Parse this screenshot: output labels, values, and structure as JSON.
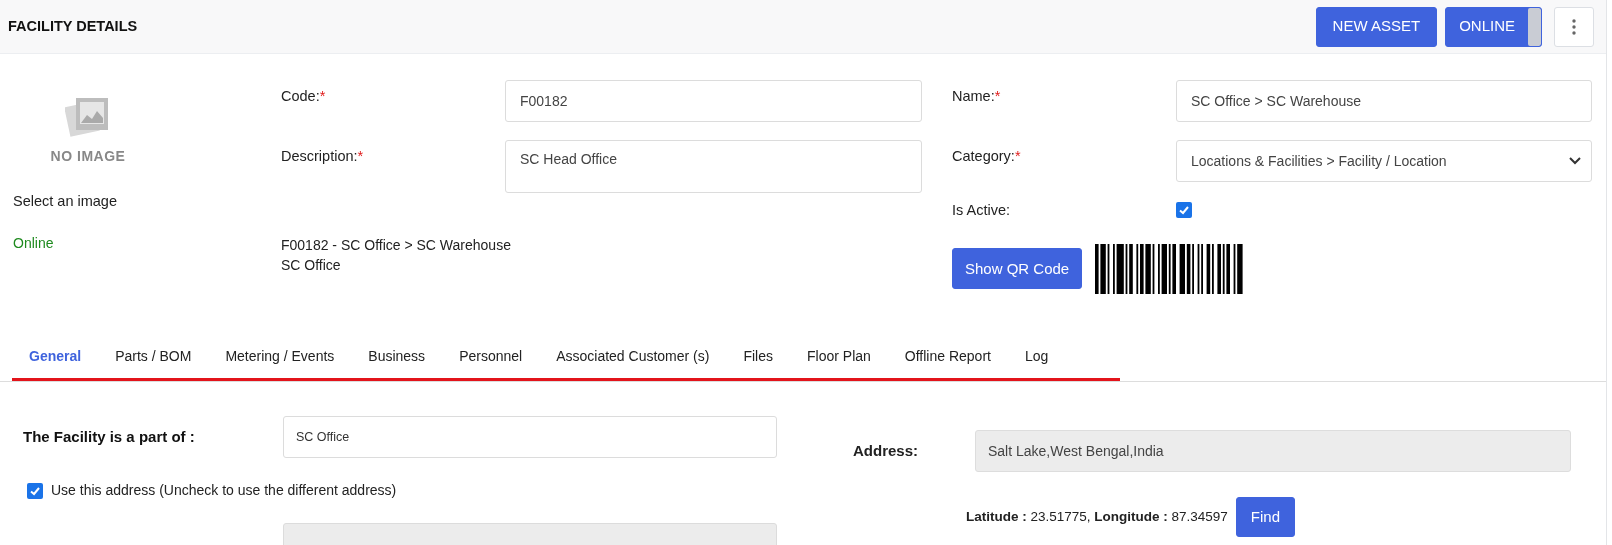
{
  "header": {
    "title": "FACILITY DETAILS",
    "new_button": "NEW ASSET",
    "online_toggle": {
      "label": "ONLINE",
      "on": true
    }
  },
  "image_panel": {
    "caption": "NO IMAGE",
    "select_label": "Select an image",
    "status": "Online"
  },
  "fields": [
    {
      "label": "Code:",
      "required_mark": "*",
      "value": "F00182",
      "kind": "input"
    },
    {
      "label": "Description:",
      "required_mark": "*",
      "value": "SC Head Office",
      "kind": "textarea"
    }
  ],
  "summary": [
    "F00182 - SC Office > SC Warehouse",
    "SC Office"
  ],
  "right_fields": [
    {
      "label": "Name:",
      "required_mark": "*",
      "value": "SC Office > SC Warehouse",
      "kind": "input"
    },
    {
      "label": "Category:",
      "required_mark": "*",
      "value": "Locations & Facilities > Facility / Location",
      "kind": "select"
    },
    {
      "label": "Is Active:",
      "checked": true,
      "kind": "checkbox"
    }
  ],
  "qr_button": "Show QR Code",
  "tabs": [
    {
      "label": "General",
      "selected": true
    },
    {
      "label": "Parts / BOM",
      "selected": false
    },
    {
      "label": "Metering / Events",
      "selected": false
    },
    {
      "label": "Business",
      "selected": false
    },
    {
      "label": "Personnel",
      "selected": false
    },
    {
      "label": "Associated Customer (s)",
      "selected": false
    },
    {
      "label": "Files",
      "selected": false
    },
    {
      "label": "Floor Plan",
      "selected": false
    },
    {
      "label": "Offline Report",
      "selected": false
    },
    {
      "label": "Log",
      "selected": false
    }
  ],
  "general": {
    "part_of": {
      "label": "The Facility is a part of :",
      "value": "SC Office"
    },
    "use_address": {
      "label": "Use this address (Uncheck to use the different address)",
      "checked": true
    },
    "address": {
      "label": "Address:",
      "value": "Salt Lake,West Bengal,India"
    },
    "coordinates": "**Latitude :** 23.51775, **Longitude :** 87.34597",
    "find_button": "Find"
  }
}
